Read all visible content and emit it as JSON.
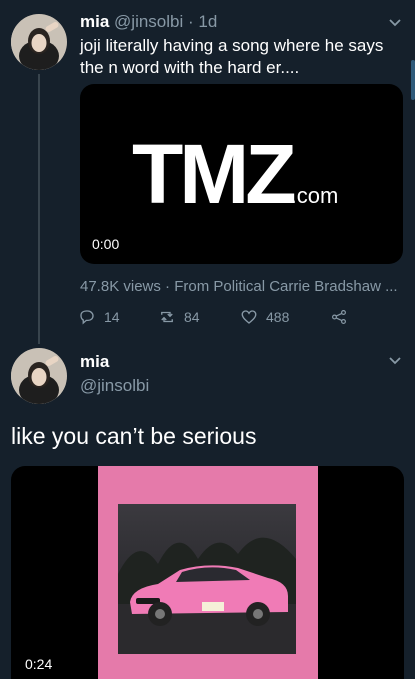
{
  "tweet1": {
    "display_name": "mia",
    "handle": "@jinsolbi",
    "time": "1d",
    "text_line1": "joji literally having a song where he says",
    "text_line2": "the n word with the hard er....",
    "video": {
      "logo_text": "TMZ",
      "logo_suffix": ".com",
      "timestamp": "0:00"
    },
    "meta": "47.8K views · From Political Carrie Bradshaw ...",
    "actions": {
      "reply_count": "14",
      "retweet_count": "84",
      "like_count": "488"
    }
  },
  "tweet2": {
    "display_name": "mia",
    "handle": "@jinsolbi",
    "text": "like you can’t be serious",
    "video": {
      "timestamp": "0:24"
    }
  },
  "colors": {
    "background": "#15202b",
    "muted": "#8899a6",
    "accent": "#1da1f2",
    "album_pink": "#e57aaa"
  }
}
